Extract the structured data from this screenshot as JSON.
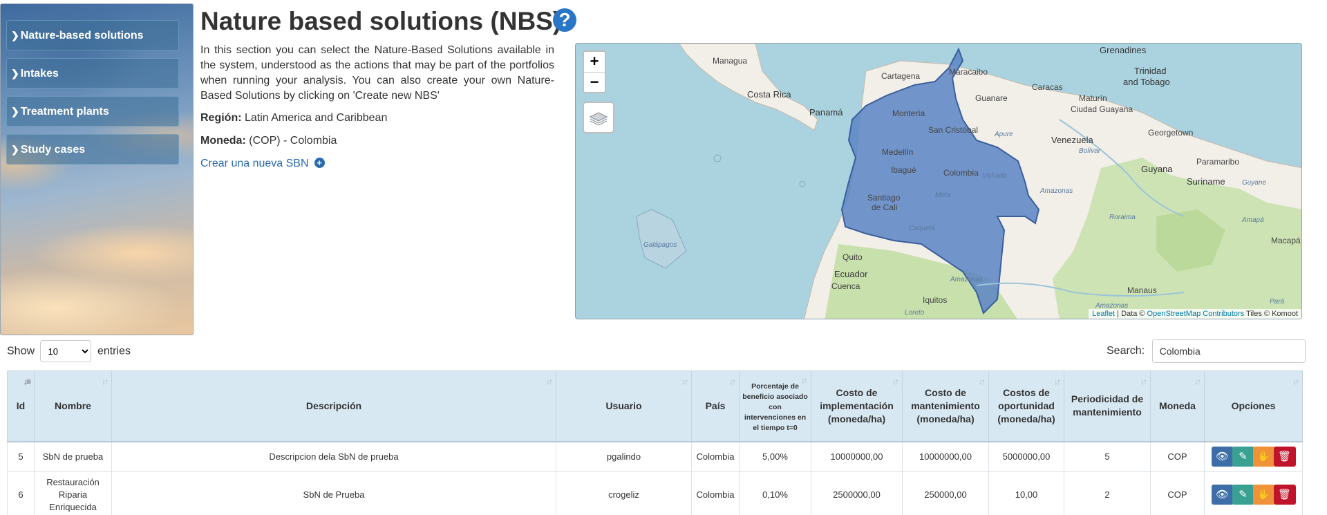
{
  "sidebar": {
    "items": [
      {
        "label": "Nature-based solutions"
      },
      {
        "label": "Intakes"
      },
      {
        "label": "Treatment plants"
      },
      {
        "label": "Study cases"
      }
    ]
  },
  "header": {
    "title": "Nature based solutions (NBS)",
    "help": "?"
  },
  "intro": {
    "description": "In this section you can select the Nature-Based Solutions available in the system, understood as the actions that may be part of the portfolios when running your analysis. You can also create your own Nature-Based Solutions by clicking on 'Create new NBS'",
    "region_label": "Región:",
    "region_value": "Latin America and Caribbean",
    "currency_label": "Moneda:",
    "currency_value": "(COP) - Colombia",
    "create_link": "Crear una nueva SBN"
  },
  "map": {
    "zoom_in": "+",
    "zoom_out": "−",
    "attribution": {
      "leaflet": "Leaflet",
      "data_prefix": "| Data ©",
      "osm": "OpenStreetMap Contributors",
      "tiles": "Tiles © Komoot"
    },
    "labels": {
      "managua": "Managua",
      "grenadines": "Grenadines",
      "cartagena": "Cartagena",
      "maracaibo": "Maracaibo",
      "trinidad": "Trinidad",
      "tobago": "and Tobago",
      "costa_rica": "Costa Rica",
      "caracas": "Caracas",
      "guanare": "Guanare",
      "maturin": "Maturín",
      "ciudad_guayana": "Ciudad Guayana",
      "panama": "Panamá",
      "monteria": "Montería",
      "san_cristobal": "San Cristóbal",
      "georgetown": "Georgetown",
      "apure": "Apure",
      "venezuela": "Venezuela",
      "bolivar": "Bolívar",
      "medellin": "Medellín",
      "paramaribo": "Paramaribo",
      "guyana": "Guyana",
      "ibague": "Ibagué",
      "colombia": "Colombia",
      "vichada": "Vichada",
      "suriname": "Suriname",
      "guyane": "Guyane",
      "amazonas1": "Amazonas",
      "santiago": "Santiago",
      "de_cali": "de Cali",
      "meta": "Meta",
      "roraima": "Roraima",
      "amapa": "Amapá",
      "galapagos": "Galápagos",
      "caqueta": "Caquetá",
      "macapa": "Macapá",
      "quito": "Quito",
      "ecuador": "Ecuador",
      "cuenca": "Cuenca",
      "amazonas2": "Amazonas",
      "iquitos": "Iquitos",
      "manaus": "Manaus",
      "amazonas3": "Amazonas",
      "para": "Pará",
      "loreto": "Loreto"
    }
  },
  "table_controls": {
    "show_label": "Show",
    "entries_label": "entries",
    "page_size": "10",
    "search_label": "Search:",
    "search_value": "Colombia"
  },
  "table": {
    "headers": {
      "id": "Id",
      "nombre": "Nombre",
      "descripcion": "Descripción",
      "usuario": "Usuario",
      "pais": "País",
      "porcentaje": "Porcentaje de beneficio asociado con intervenciones en el tiempo t=0",
      "costo_impl": "Costo de implementación (moneda/ha)",
      "costo_mant": "Costo de mantenimiento (moneda/ha)",
      "costo_oport": "Costos de oportunidad (moneda/ha)",
      "periodicidad": "Periodicidad de mantenimiento",
      "moneda": "Moneda",
      "opciones": "Opciones"
    },
    "rows": [
      {
        "id": "5",
        "nombre": "SbN de prueba",
        "descripcion": "Descripcion dela SbN de prueba",
        "usuario": "pgalindo",
        "pais": "Colombia",
        "porcentaje": "5,00%",
        "costo_impl": "10000000,00",
        "costo_mant": "10000000,00",
        "costo_oport": "5000000,00",
        "periodicidad": "5",
        "moneda": "COP"
      },
      {
        "id": "6",
        "nombre": "Restauración Riparia Enriquecida",
        "descripcion": "SbN de Prueba",
        "usuario": "crogeliz",
        "pais": "Colombia",
        "porcentaje": "0,10%",
        "costo_impl": "2500000,00",
        "costo_mant": "250000,00",
        "costo_oport": "10,00",
        "periodicidad": "2",
        "moneda": "COP"
      }
    ]
  },
  "colors": {
    "accent_blue": "#2a76c6",
    "header_bg": "#d7e8f3",
    "view_btn": "#3d6ea8",
    "edit_btn": "#3aa192",
    "clone_btn": "#f0923a",
    "delete_btn": "#c0142a",
    "colombia_fill": "#5b84c4"
  }
}
